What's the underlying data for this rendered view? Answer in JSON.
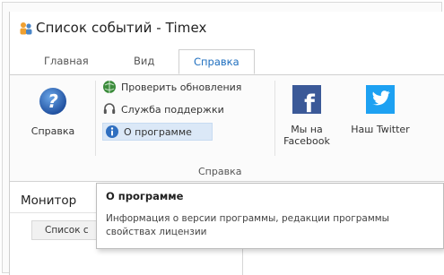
{
  "window": {
    "title": "Список событий - Timex"
  },
  "tabs": [
    {
      "label": "Главная"
    },
    {
      "label": "Вид"
    },
    {
      "label": "Справка"
    }
  ],
  "ribbon": {
    "help_button": {
      "label": "Справка",
      "icon": "help-question-icon"
    },
    "check_updates": {
      "label": "Проверить обновления",
      "icon": "globe-update-icon"
    },
    "support": {
      "label": "Служба поддержки",
      "icon": "headset-icon"
    },
    "about": {
      "label": "О программе",
      "icon": "info-icon"
    },
    "facebook": {
      "label_line1": "Мы на",
      "label_line2": "Facebook",
      "icon": "facebook-icon"
    },
    "twitter": {
      "label": "Наш Twitter",
      "icon": "twitter-icon"
    },
    "group_label": "Справка"
  },
  "panel": {
    "title": "Монитор",
    "list_button": "Список с"
  },
  "tooltip": {
    "title": "О программе",
    "line1": "Информация о версии программы, редакции программы",
    "line2": "свойствах лицензии"
  },
  "colors": {
    "accent": "#1f6fbf",
    "facebook": "#3b5998",
    "twitter": "#1da1f2",
    "highlight": "#dbe8f7"
  }
}
